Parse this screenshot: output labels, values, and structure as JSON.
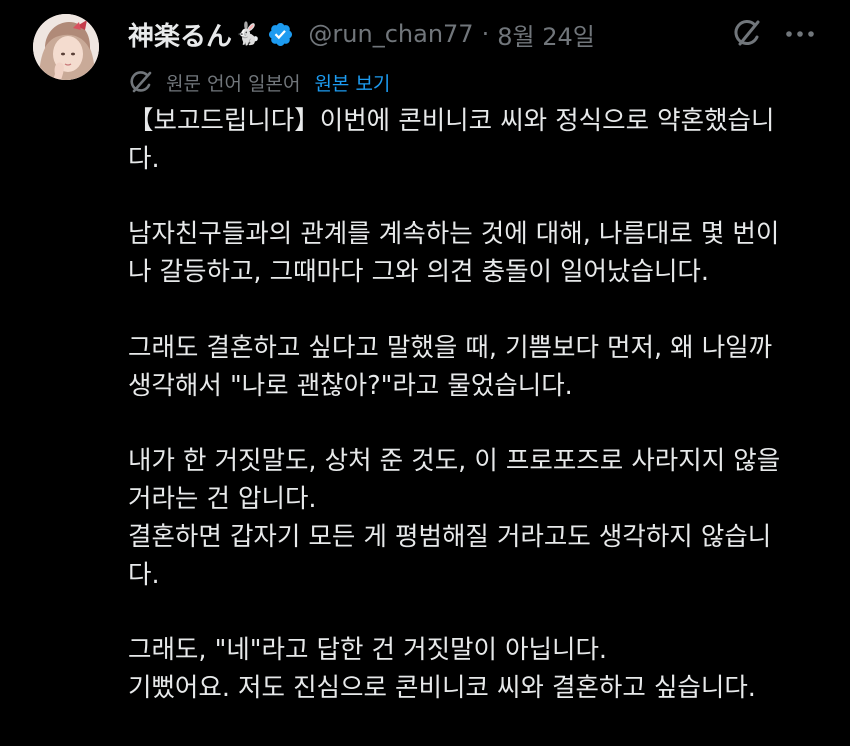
{
  "tweet": {
    "author": {
      "display_name": "神楽るん",
      "emoji": "🐇",
      "handle": "@run_chan77",
      "separator": "·",
      "date": "8월 24일",
      "verified_color": "#1d9bf0"
    },
    "translation": {
      "note": "원문 언어 일본어",
      "show_original": "원본 보기"
    },
    "body_lines": [
      "【보고드립니다】이번에 콘비니코 씨와 정식으로 약혼했습니",
      "다.",
      "",
      "남자친구들과의 관계를 계속하는 것에 대해, 나름대로 몇 번이",
      "나 갈등하고, 그때마다 그와 의견 충돌이 일어났습니다.",
      "",
      "그래도 결혼하고 싶다고 말했을 때, 기쁨보다 먼저, 왜 나일까",
      "생각해서 \"나로 괜찮아?\"라고 물었습니다.",
      "",
      "내가 한 거짓말도, 상처 준 것도, 이 프로포즈로 사라지지 않을",
      "거라는 건 압니다.",
      "결혼하면 갑자기 모든 게 평범해질 거라고도 생각하지 않습니",
      "다.",
      "",
      "그래도, \"네\"라고 답한 건 거짓말이 아닙니다.",
      "기뻤어요. 저도 진심으로 콘비니코 씨와 결혼하고 싶습니다."
    ]
  },
  "icons": {
    "grok": "grok-icon",
    "more": "more-icon",
    "translate": "translate-icon",
    "verified": "verified-badge-icon"
  },
  "colors": {
    "background": "#000000",
    "text": "#e7e9ea",
    "muted": "#71767b",
    "link": "#1d9bf0"
  }
}
